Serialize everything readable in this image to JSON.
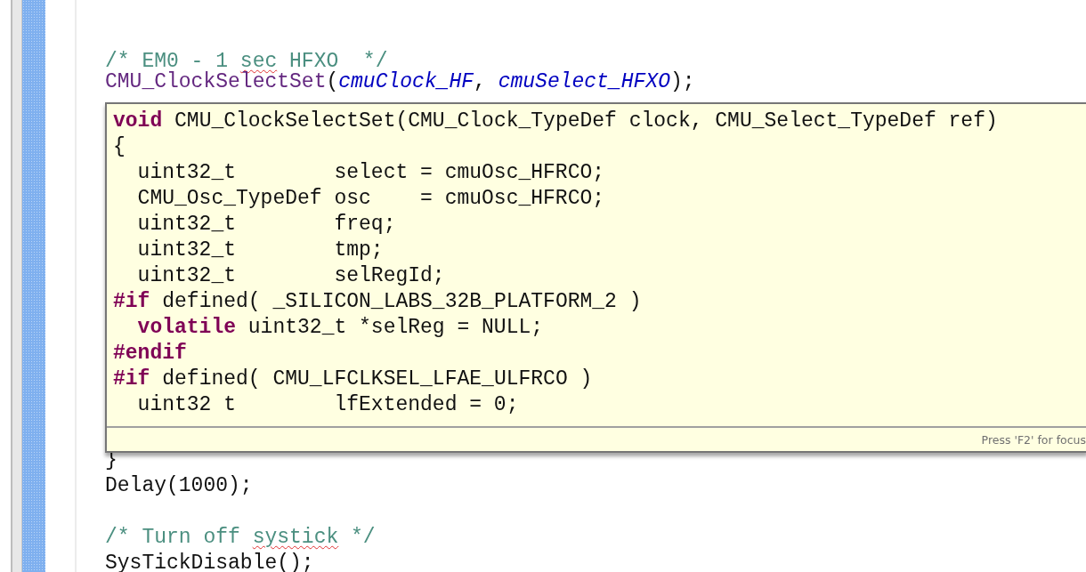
{
  "editor": {
    "lines_above": [
      {
        "kind": "code",
        "indent": false,
        "segments": [
          {
            "text": "/* EM0 - 1 ",
            "kind": "comment"
          },
          {
            "text": "sec",
            "kind": "typo"
          },
          {
            "text": " HFXO  */",
            "kind": "comment"
          }
        ]
      },
      {
        "kind": "code",
        "indent": false,
        "segments": [
          {
            "text": "CMU_ClockSelectSet",
            "kind": "function"
          },
          {
            "text": "(",
            "kind": "plain"
          },
          {
            "text": "cmuClock_HF",
            "kind": "constant"
          },
          {
            "text": ", ",
            "kind": "plain"
          },
          {
            "text": "cmuSelect_HFXO",
            "kind": "constant"
          },
          {
            "text": ");",
            "kind": "plain"
          }
        ]
      }
    ],
    "lines_below": [
      {
        "kind": "code",
        "indent": false,
        "segments": [
          {
            "text": "}",
            "kind": "plain"
          }
        ]
      },
      {
        "kind": "code",
        "indent": false,
        "segments": [
          {
            "text": "Delay(1000);",
            "kind": "plain"
          }
        ]
      },
      {
        "kind": "blank"
      },
      {
        "kind": "code",
        "indent": false,
        "segments": [
          {
            "text": "/* Turn off ",
            "kind": "comment"
          },
          {
            "text": "systick",
            "kind": "typo"
          },
          {
            "text": " */",
            "kind": "comment"
          }
        ]
      },
      {
        "kind": "code",
        "indent": false,
        "segments": [
          {
            "text": "SysTickDisable();",
            "kind": "plain"
          }
        ]
      }
    ]
  },
  "hover_popup": {
    "lines": [
      {
        "kind": "code",
        "indent": false,
        "segments": [
          {
            "text": "void",
            "kind": "keyword"
          },
          {
            "text": " CMU_ClockSelectSet(CMU_Clock_TypeDef clock, CMU_Select_TypeDef ref)",
            "kind": "plain"
          }
        ]
      },
      {
        "kind": "code",
        "indent": false,
        "segments": [
          {
            "text": "{",
            "kind": "plain"
          }
        ]
      },
      {
        "kind": "code",
        "indent": true,
        "segments": [
          {
            "text": "uint32_t        select = cmuOsc_HFRCO;",
            "kind": "plain"
          }
        ]
      },
      {
        "kind": "code",
        "indent": true,
        "segments": [
          {
            "text": "CMU_Osc_TypeDef osc    = cmuOsc_HFRCO;",
            "kind": "plain"
          }
        ]
      },
      {
        "kind": "code",
        "indent": true,
        "segments": [
          {
            "text": "uint32_t        freq;",
            "kind": "plain"
          }
        ]
      },
      {
        "kind": "code",
        "indent": true,
        "segments": [
          {
            "text": "uint32_t        tmp;",
            "kind": "plain"
          }
        ]
      },
      {
        "kind": "code",
        "indent": true,
        "segments": [
          {
            "text": "uint32_t        selRegId;",
            "kind": "plain"
          }
        ]
      },
      {
        "kind": "code",
        "indent": false,
        "segments": [
          {
            "text": "#if",
            "kind": "keyword"
          },
          {
            "text": " defined( _SILICON_LABS_32B_PLATFORM_2 )",
            "kind": "plain"
          }
        ]
      },
      {
        "kind": "code",
        "indent": true,
        "segments": [
          {
            "text": "volatile",
            "kind": "keyword"
          },
          {
            "text": " uint32_t *selReg = NULL;",
            "kind": "plain"
          }
        ]
      },
      {
        "kind": "code",
        "indent": false,
        "segments": [
          {
            "text": "#endif",
            "kind": "keyword"
          }
        ]
      },
      {
        "kind": "code",
        "indent": false,
        "segments": [
          {
            "text": "#if",
            "kind": "keyword"
          },
          {
            "text": " defined( CMU_LFCLKSEL_LFAE_ULFRCO )",
            "kind": "plain"
          }
        ]
      },
      {
        "kind": "code",
        "indent": true,
        "segments": [
          {
            "text": "uint32 t        lfExtended = 0;",
            "kind": "plain"
          }
        ]
      }
    ],
    "footer": "Press 'F2' for focus"
  }
}
